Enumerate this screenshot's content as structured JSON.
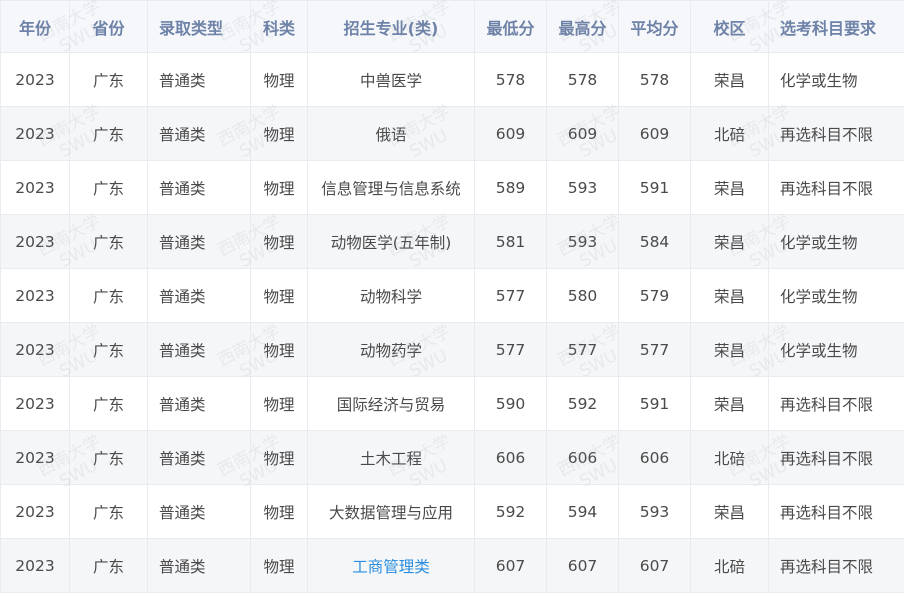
{
  "watermark": {
    "line1": "西南大学",
    "line2": "SWU"
  },
  "table": {
    "headers": [
      "年份",
      "省份",
      "录取类型",
      "科类",
      "招生专业(类)",
      "最低分",
      "最高分",
      "平均分",
      "校区",
      "选考科目要求"
    ],
    "rows": [
      [
        "2023",
        "广东",
        "普通类",
        "物理",
        "中兽医学",
        "578",
        "578",
        "578",
        "荣昌",
        "化学或生物"
      ],
      [
        "2023",
        "广东",
        "普通类",
        "物理",
        "俄语",
        "609",
        "609",
        "609",
        "北碚",
        "再选科目不限"
      ],
      [
        "2023",
        "广东",
        "普通类",
        "物理",
        "信息管理与信息系统",
        "589",
        "593",
        "591",
        "荣昌",
        "再选科目不限"
      ],
      [
        "2023",
        "广东",
        "普通类",
        "物理",
        "动物医学(五年制)",
        "581",
        "593",
        "584",
        "荣昌",
        "化学或生物"
      ],
      [
        "2023",
        "广东",
        "普通类",
        "物理",
        "动物科学",
        "577",
        "580",
        "579",
        "荣昌",
        "化学或生物"
      ],
      [
        "2023",
        "广东",
        "普通类",
        "物理",
        "动物药学",
        "577",
        "577",
        "577",
        "荣昌",
        "化学或生物"
      ],
      [
        "2023",
        "广东",
        "普通类",
        "物理",
        "国际经济与贸易",
        "590",
        "592",
        "591",
        "荣昌",
        "再选科目不限"
      ],
      [
        "2023",
        "广东",
        "普通类",
        "物理",
        "土木工程",
        "606",
        "606",
        "606",
        "北碚",
        "再选科目不限"
      ],
      [
        "2023",
        "广东",
        "普通类",
        "物理",
        "大数据管理与应用",
        "592",
        "594",
        "593",
        "荣昌",
        "再选科目不限"
      ],
      [
        "2023",
        "广东",
        "普通类",
        "物理",
        "工商管理类",
        "607",
        "607",
        "607",
        "北碚",
        "再选科目不限"
      ]
    ],
    "link_rows": [
      9
    ]
  },
  "colors": {
    "header_text": "#6e82a8",
    "link": "#2a8de0",
    "stripe": "#f5f6f8"
  }
}
